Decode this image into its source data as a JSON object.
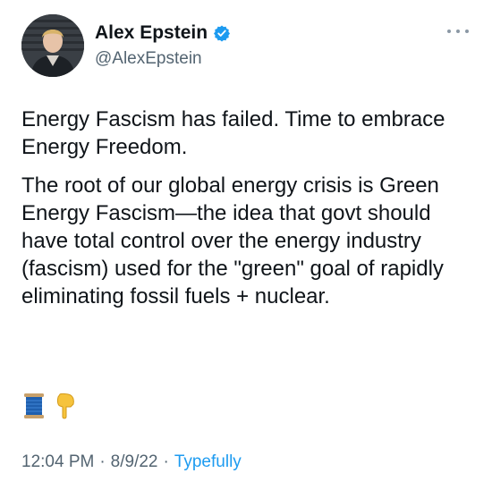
{
  "author": {
    "display_name": "Alex Epstein",
    "handle": "@AlexEpstein",
    "verified": true,
    "verified_color": "#1d9bf0"
  },
  "tweet": {
    "paragraphs": [
      "Energy Fascism has failed. Time to embrace Energy Freedom.",
      "The root of our global energy crisis is Green Energy Fascism—the idea that govt should have total control over the energy industry (fascism) used for the \"green\" goal of rapidly eliminating fossil fuels + nuclear."
    ],
    "emojis": [
      "spool-of-thread-icon",
      "backhand-pointing-down-icon"
    ]
  },
  "meta": {
    "time": "12:04 PM",
    "separator": "·",
    "date": "8/9/22",
    "source": "Typefully",
    "source_color": "#1d9bf0"
  },
  "menu": {
    "icon": "more-options-icon"
  }
}
